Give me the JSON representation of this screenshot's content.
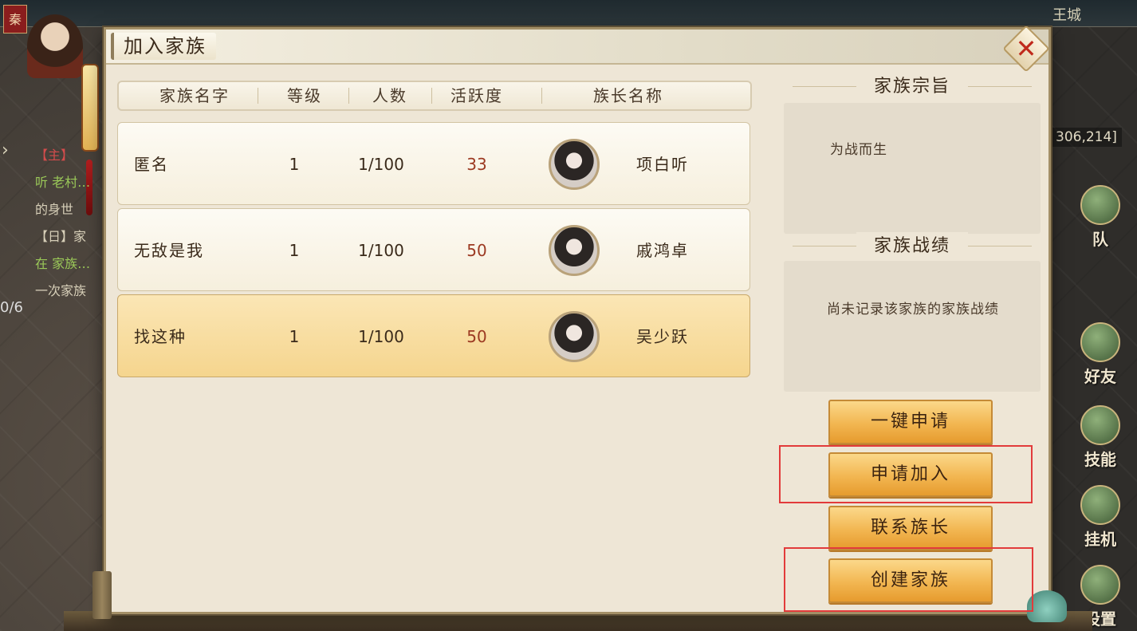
{
  "background": {
    "city_label": "王城",
    "faction_badge": "秦",
    "coord_readout": "306,214]",
    "left_counter": "0/6",
    "chat_lines": [
      {
        "channel": "【主】",
        "text": ""
      },
      {
        "channel": "",
        "text": "听 老村…"
      },
      {
        "channel": "",
        "text": "的身世"
      },
      {
        "channel": "【日】",
        "text": "家"
      },
      {
        "channel": "",
        "text": "在 家族…"
      },
      {
        "channel": "",
        "text": "一次家族"
      }
    ],
    "right_icons": [
      {
        "label": "队",
        "icon": "team-icon"
      },
      {
        "label": "好友",
        "icon": "friends-icon"
      },
      {
        "label": "技能",
        "icon": "skills-icon"
      },
      {
        "label": "挂机",
        "icon": "auto-battle-icon"
      },
      {
        "label": "设置",
        "icon": "settings-icon"
      }
    ]
  },
  "dialog": {
    "title": "加入家族",
    "close_icon": "close-icon",
    "close_glyph": "✕",
    "columns": [
      "家族名字",
      "等级",
      "人数",
      "活跃度",
      "族长名称"
    ],
    "families": [
      {
        "name": "匿名",
        "level": "1",
        "members": "1/100",
        "activity": "33",
        "leader": "项白听",
        "avatar": "female-leader-avatar",
        "selected": false
      },
      {
        "name": "无敌是我",
        "level": "1",
        "members": "1/100",
        "activity": "50",
        "leader": "戚鸿卓",
        "avatar": "male-leader-avatar",
        "selected": false
      },
      {
        "name": "找这种",
        "level": "1",
        "members": "1/100",
        "activity": "50",
        "leader": "吴少跃",
        "avatar": "male-leader-avatar",
        "selected": true
      }
    ],
    "purpose": {
      "header": "家族宗旨",
      "text": "为战而生"
    },
    "record": {
      "header": "家族战绩",
      "text": "尚未记录该家族的家族战绩"
    },
    "buttons": {
      "one_click_apply": "一键申请",
      "apply_join": "申请加入",
      "contact_leader": "联系族长",
      "create_family": "创建家族"
    }
  },
  "colors": {
    "highlight": "#e23b3b",
    "activity_value": "#9c3a22",
    "button_gold": "#f2b651",
    "selected_row": "#f5d58e"
  }
}
